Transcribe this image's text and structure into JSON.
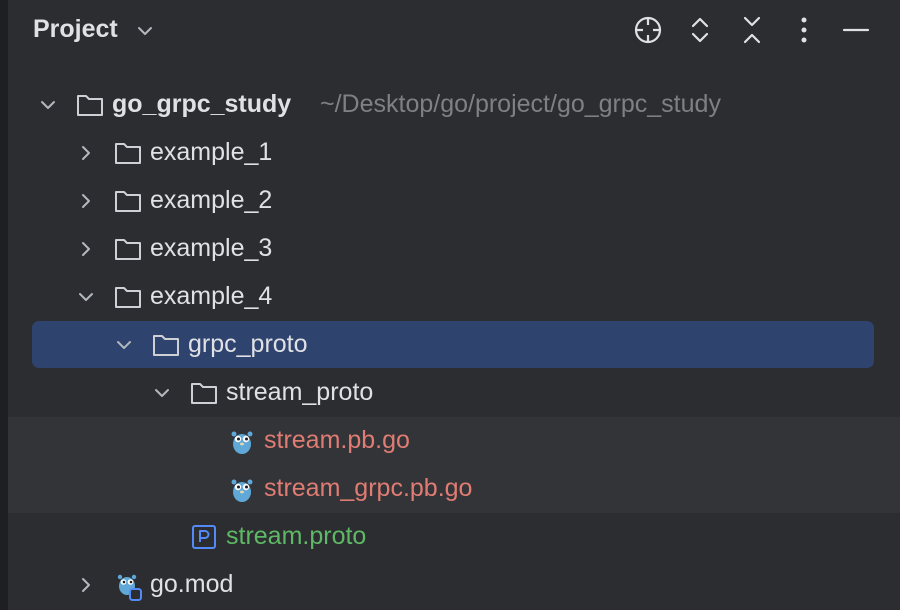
{
  "header": {
    "title": "Project",
    "icons": [
      "locate-icon",
      "expand-collapse-icon",
      "collapse-all-icon",
      "more-options-icon",
      "minimize-icon"
    ]
  },
  "tree": {
    "root": {
      "label": "go_grpc_study",
      "path": "~/Desktop/go/project/go_grpc_study",
      "icon": "folder-icon",
      "expanded": true
    },
    "items": [
      {
        "label": "example_1",
        "icon": "folder-icon",
        "expanded": false
      },
      {
        "label": "example_2",
        "icon": "folder-icon",
        "expanded": false
      },
      {
        "label": "example_3",
        "icon": "folder-icon",
        "expanded": false
      },
      {
        "label": "example_4",
        "icon": "folder-icon",
        "expanded": true
      },
      {
        "label": "grpc_proto",
        "icon": "folder-icon",
        "expanded": true,
        "selected": true
      },
      {
        "label": "stream_proto",
        "icon": "folder-icon",
        "expanded": true
      },
      {
        "label": "stream.pb.go",
        "icon": "gopher-icon",
        "color": "#e07c73"
      },
      {
        "label": "stream_grpc.pb.go",
        "icon": "gopher-icon",
        "color": "#e07c73"
      },
      {
        "label": "stream.proto",
        "icon": "proto-file-icon",
        "color": "#5fb865"
      },
      {
        "label": "go.mod",
        "icon": "go-mod-icon",
        "expanded": false
      }
    ]
  },
  "colors": {
    "background": "#2b2d30",
    "selection": "#2e436e",
    "text": "#dfe1e5",
    "modified_file": "#e07c73",
    "new_file": "#5fb865",
    "path_text": "#7f8084"
  }
}
